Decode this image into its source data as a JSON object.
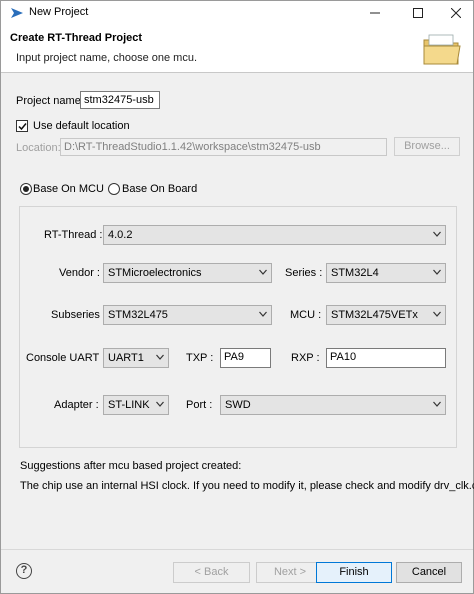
{
  "window": {
    "title": "New Project"
  },
  "banner": {
    "title": "Create RT-Thread Project",
    "description": "Input project name, choose one mcu."
  },
  "project_name": {
    "label": "Project name:",
    "value": "stm32475-usb"
  },
  "use_default_location": {
    "label": "Use default location",
    "checked": true
  },
  "location": {
    "label": "Location:",
    "value": "D:\\RT-ThreadStudio1.1.42\\workspace\\stm32475-usb",
    "browse_label": "Browse..."
  },
  "base_on": {
    "mcu_label": "Base On MCU",
    "board_label": "Base On Board",
    "selected": "mcu"
  },
  "rt_thread": {
    "label": "RT-Thread :",
    "value": "4.0.2"
  },
  "vendor": {
    "label": "Vendor :",
    "value": "STMicroelectronics"
  },
  "series": {
    "label": "Series :",
    "value": "STM32L4"
  },
  "subseries": {
    "label": "Subseries :",
    "value": "STM32L475"
  },
  "mcu": {
    "label": "MCU :",
    "value": "STM32L475VETx"
  },
  "console_uart": {
    "label": "Console UART :",
    "value": "UART1"
  },
  "txp": {
    "label": "TXP :",
    "value": "PA9"
  },
  "rxp": {
    "label": "RXP :",
    "value": "PA10"
  },
  "adapter": {
    "label": "Adapter :",
    "value": "ST-LINK"
  },
  "port": {
    "label": "Port :",
    "value": "SWD"
  },
  "suggestions": {
    "heading": "Suggestions after mcu based project created:",
    "text": "The chip use an internal HSI clock. If you need to modify it, please check and modify drv_clk.c"
  },
  "footer": {
    "back_label": "< Back",
    "next_label": "Next >",
    "finish_label": "Finish",
    "cancel_label": "Cancel"
  },
  "icons": {
    "app": "rt-thread-app-icon",
    "banner": "folder-icon",
    "help": "help-icon"
  },
  "colors": {
    "accent": "#0078d7",
    "disabled_text": "#a0a0a0"
  }
}
